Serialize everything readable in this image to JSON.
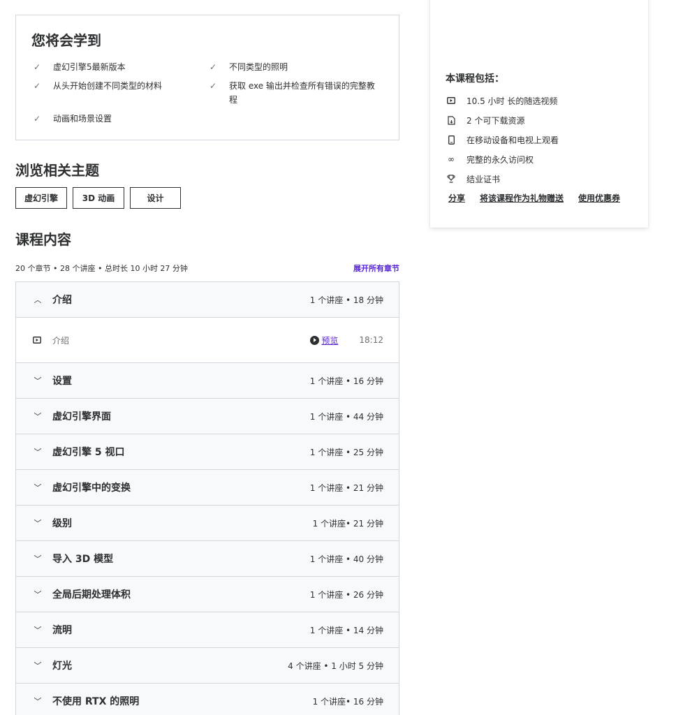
{
  "learn": {
    "title": "您将会学到",
    "items": [
      "虚幻引擎5最新版本",
      "不同类型的照明",
      "从头开始创建不同类型的材料",
      "获取 exe 输出并检查所有错误的完整教程",
      "动画和场景设置"
    ]
  },
  "topics": {
    "title": "浏览相关主题",
    "items": [
      "虚幻引擎",
      "3D 动画",
      "设计"
    ]
  },
  "content": {
    "title": "课程内容",
    "summary": "20 个章节 • 28 个讲座 • 总时长 10 小时 27 分钟",
    "expand_all": "展开所有章节",
    "sections": [
      {
        "title": "介绍",
        "meta": "1 个讲座 • 18 分钟",
        "expanded": true,
        "lectures": [
          {
            "title": "介绍",
            "preview": "预览",
            "duration": "18:12"
          }
        ]
      },
      {
        "title": "设置",
        "meta": "1 个讲座 • 16 分钟"
      },
      {
        "title": "虚幻引擎界面",
        "meta": "1 个讲座 • 44 分钟"
      },
      {
        "title": "虚幻引擎 5 视口",
        "meta": "1 个讲座 • 25 分钟"
      },
      {
        "title": "虚幻引擎中的变换",
        "meta": "1 个讲座 • 21 分钟"
      },
      {
        "title": "级别",
        "meta": "1 个讲座• 21 分钟"
      },
      {
        "title": "导入 3D 模型",
        "meta": "1 个讲座 • 40 分钟"
      },
      {
        "title": "全局后期处理体积",
        "meta": "1 个讲座 • 26 分钟"
      },
      {
        "title": "流明",
        "meta": "1 个讲座 • 14 分钟"
      },
      {
        "title": "灯光",
        "meta": "4 个讲座 • 1 小时 5 分钟"
      },
      {
        "title": "不使用 RTX 的照明",
        "meta": "1 个讲座• 16 分钟"
      }
    ]
  },
  "sidebar": {
    "includes_title": "本课程包括：",
    "includes": [
      {
        "icon": "video-icon",
        "text": "10.5 小时 长的随选视频"
      },
      {
        "icon": "download-file-icon",
        "text": "2 个可下载资源"
      },
      {
        "icon": "mobile-icon",
        "text": "在移动设备和电视上观看"
      },
      {
        "icon": "infinity-icon",
        "text": "完整的永久访问权"
      },
      {
        "icon": "trophy-icon",
        "text": "结业证书"
      }
    ],
    "links": [
      "分享",
      "将该课程作为礼物赠送",
      "使用优惠券"
    ]
  },
  "colors": {
    "accent": "#5624d0",
    "text": "#2d2f31",
    "border": "#d1d7dc",
    "section_bg": "#f7f9fa"
  }
}
